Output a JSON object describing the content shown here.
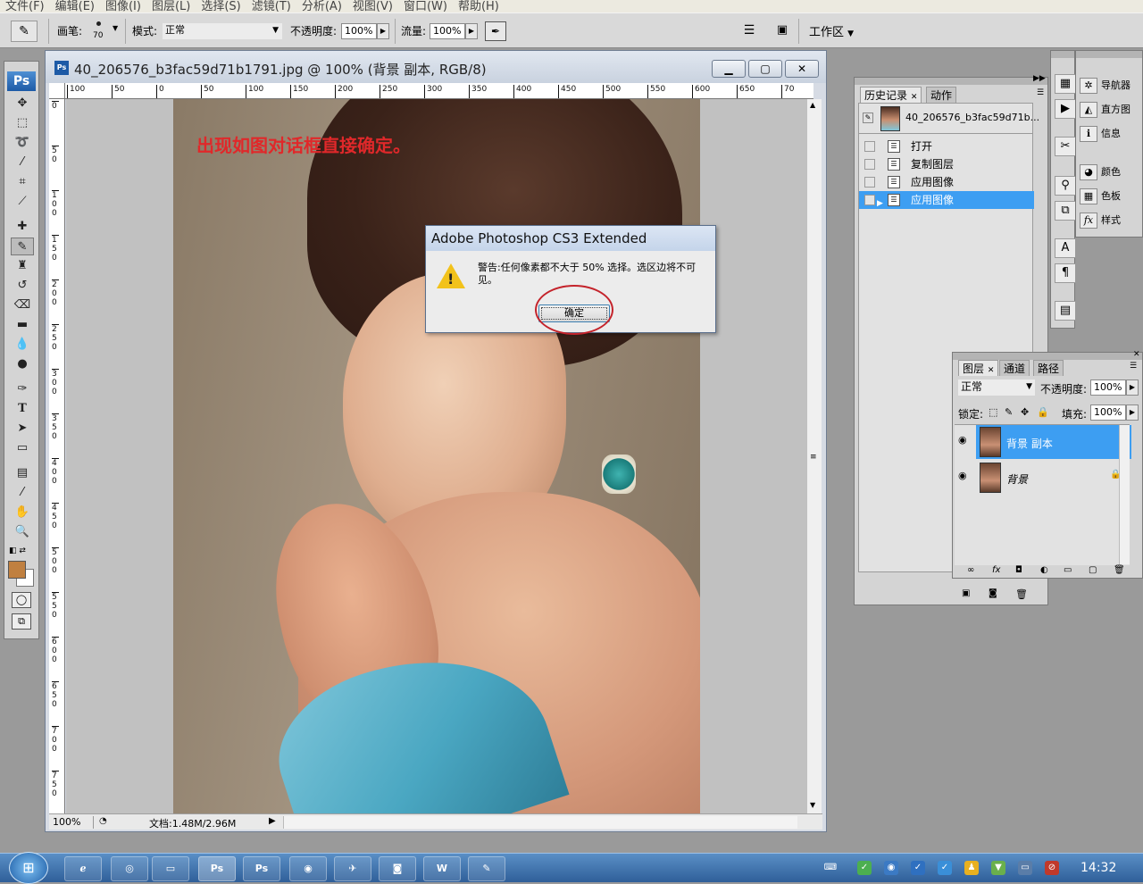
{
  "menubar": [
    "文件(F)",
    "编辑(E)",
    "图像(I)",
    "图层(L)",
    "选择(S)",
    "滤镜(T)",
    "分析(A)",
    "视图(V)",
    "窗口(W)",
    "帮助(H)"
  ],
  "options": {
    "brush_label": "画笔:",
    "brush_size": "70",
    "mode_label": "模式:",
    "mode_value": "正常",
    "opacity_label": "不透明度:",
    "opacity_value": "100%",
    "flow_label": "流量:",
    "flow_value": "100%",
    "workspace_label": "工作区"
  },
  "document": {
    "title": "40_206576_b3fac59d71b1791.jpg @ 100% (背景 副本, RGB/8)",
    "zoom": "100%",
    "doc_info": "文档:1.48M/2.96M",
    "ruler_h": [
      "100",
      "50",
      "0",
      "50",
      "100",
      "150",
      "200",
      "250",
      "300",
      "350",
      "400",
      "450",
      "500",
      "550",
      "600",
      "650",
      "70"
    ],
    "ruler_v": [
      "0",
      "50",
      "100",
      "150",
      "200",
      "250",
      "300",
      "350",
      "400",
      "450",
      "500",
      "550",
      "600",
      "650",
      "700",
      "750"
    ],
    "annotation": "出现如图对话框直接确定。"
  },
  "dialog": {
    "title": "Adobe Photoshop CS3 Extended",
    "message": "警告:任何像素都不大于 50% 选择。选区边将不可见。",
    "ok_label": "确定",
    "icon": "warning-icon"
  },
  "history": {
    "tabs": [
      "历史记录",
      "动作"
    ],
    "snapshot": "40_206576_b3fac59d71b...",
    "items": [
      "打开",
      "复制图层",
      "应用图像",
      "应用图像"
    ],
    "selected": 3
  },
  "dock": {
    "items": [
      "导航器",
      "直方图",
      "信息",
      "颜色",
      "色板",
      "样式"
    ]
  },
  "layers": {
    "tabs": [
      "图层",
      "通道",
      "路径"
    ],
    "blend_mode": "正常",
    "opacity_label": "不透明度:",
    "opacity_value": "100%",
    "lock_label": "锁定:",
    "fill_label": "填充:",
    "fill_value": "100%",
    "items": [
      {
        "name": "背景 副本",
        "selected": true
      },
      {
        "name": "背景",
        "locked": true
      }
    ]
  },
  "taskbar": {
    "apps": [
      "ie",
      "360",
      "folder",
      "Ps",
      "Ps",
      "browser",
      "plane",
      "photo",
      "W",
      "edit"
    ],
    "time": "14:32"
  },
  "colors": {
    "accent": "#3d9ef2",
    "annotation_red": "#e0282a",
    "fg_color": "#c08040"
  }
}
